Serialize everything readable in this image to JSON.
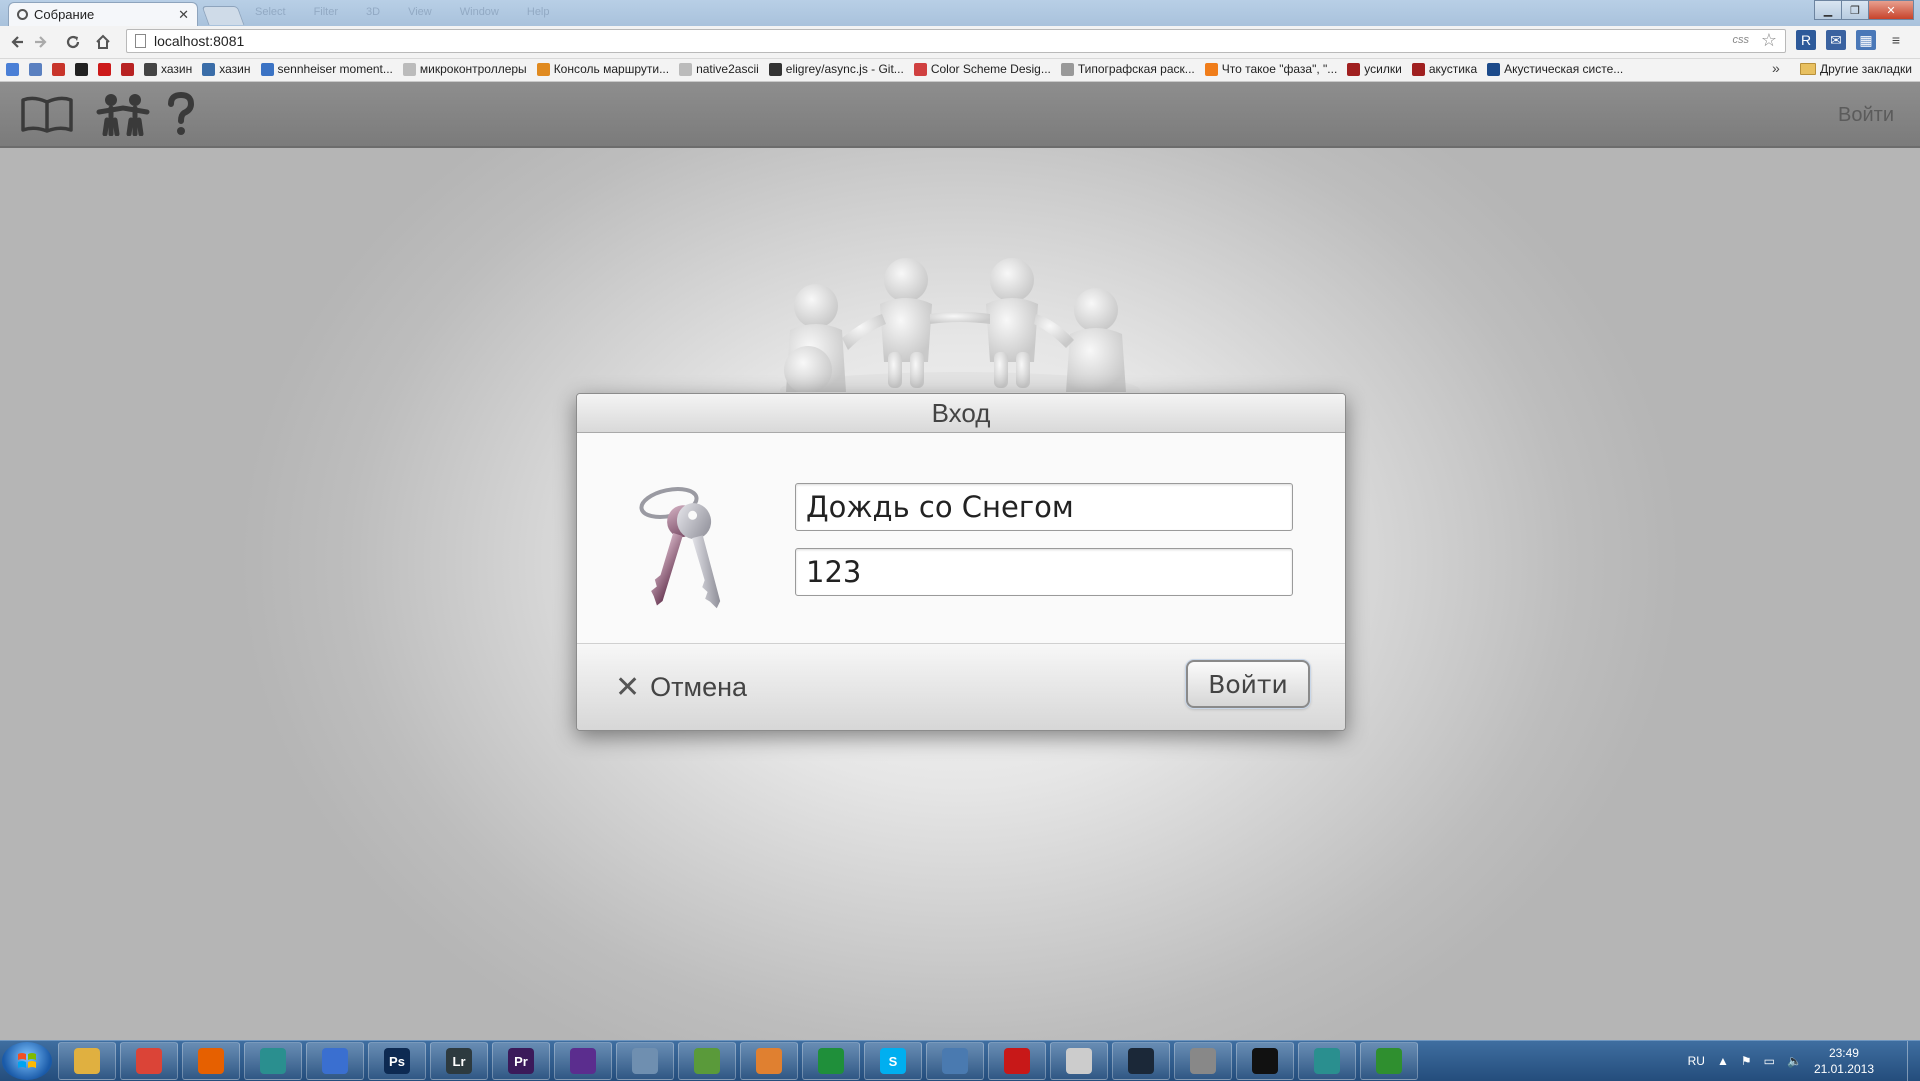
{
  "browser": {
    "tab_title": "Собрание",
    "address": "localhost:8081",
    "css_badge": "css",
    "ghost_menu": [
      "Select",
      "Filter",
      "3D",
      "View",
      "Window",
      "Help"
    ],
    "bookmarks": [
      {
        "label": "",
        "icon": "google-icon",
        "color": "#4a7fd6"
      },
      {
        "label": "",
        "icon": "h-icon",
        "color": "#5a80c0"
      },
      {
        "label": "",
        "icon": "pp-icon",
        "color": "#c8352b"
      },
      {
        "label": "",
        "icon": "infinity-icon",
        "color": "#222222"
      },
      {
        "label": "",
        "icon": "youtube-icon",
        "color": "#cc1a1a"
      },
      {
        "label": "",
        "icon": "bookmark-red-icon",
        "color": "#b82222"
      },
      {
        "label": "хазин",
        "icon": "link-icon",
        "color": "#444444"
      },
      {
        "label": "хазин",
        "icon": "chart-icon",
        "color": "#3a6da8"
      },
      {
        "label": "sennheiser moment...",
        "icon": "sennheiser-icon",
        "color": "#3b73c4"
      },
      {
        "label": "микроконтроллеры",
        "icon": "page-icon",
        "color": "#bbbbbb"
      },
      {
        "label": "Консоль маршрути...",
        "icon": "grid-icon",
        "color": "#e08a20"
      },
      {
        "label": "native2ascii",
        "icon": "page-icon",
        "color": "#bbbbbb"
      },
      {
        "label": "eligrey/async.js - Git...",
        "icon": "github-icon",
        "color": "#333333"
      },
      {
        "label": "Color Scheme Desig...",
        "icon": "color-wheel-icon",
        "color": "#d04040"
      },
      {
        "label": "Типографская раск...",
        "icon": "typography-icon",
        "color": "#999999"
      },
      {
        "label": "Что такое \"фаза\", \"...",
        "icon": "blogger-icon",
        "color": "#f07d1a"
      },
      {
        "label": "усилки",
        "icon": "f-icon",
        "color": "#a02020"
      },
      {
        "label": "акустика",
        "icon": "f-icon",
        "color": "#a02020"
      },
      {
        "label": "Акустическая систе...",
        "icon": "speaker-icon",
        "color": "#1c4a8a"
      }
    ],
    "other_bookmarks": "Другие закладки"
  },
  "app": {
    "login_link": "Войти",
    "header_icons": [
      "book-icon",
      "people-icon",
      "question-icon"
    ]
  },
  "dialog": {
    "title": "Вход",
    "username_value": "Дождь со Снегом",
    "password_value": "123",
    "cancel_label": "Отмена",
    "submit_label": "Войти"
  },
  "taskbar": {
    "apps": [
      {
        "icon": "explorer-icon",
        "label": "",
        "color": "#e0b040"
      },
      {
        "icon": "chrome-icon",
        "label": "",
        "color": "#db4437"
      },
      {
        "icon": "firefox-icon",
        "label": "",
        "color": "#e66000"
      },
      {
        "icon": "bird-icon",
        "label": "",
        "color": "#2a8f8f"
      },
      {
        "icon": "bolt-icon",
        "label": "",
        "color": "#3a6fd0"
      },
      {
        "icon": "photoshop-icon",
        "label": "Ps",
        "color": "#0d2a52"
      },
      {
        "icon": "lightroom-icon",
        "label": "Lr",
        "color": "#2d3a3f"
      },
      {
        "icon": "premiere-icon",
        "label": "Pr",
        "color": "#3b1a5a"
      },
      {
        "icon": "visual-studio-icon",
        "label": "",
        "color": "#5b2d8e"
      },
      {
        "icon": "disk-icon",
        "label": "",
        "color": "#6f8fb0"
      },
      {
        "icon": "notepad-icon",
        "label": "",
        "color": "#5a9a3a"
      },
      {
        "icon": "windows-live-icon",
        "label": "",
        "color": "#e08030"
      },
      {
        "icon": "utorrent-icon",
        "label": "",
        "color": "#1f8f3a"
      },
      {
        "icon": "skype-icon",
        "label": "S",
        "color": "#00aff0"
      },
      {
        "icon": "network-icon",
        "label": "",
        "color": "#4a7ab0"
      },
      {
        "icon": "acrobat-icon",
        "label": "",
        "color": "#c81818"
      },
      {
        "icon": "alien-icon",
        "label": "",
        "color": "#cccccc"
      },
      {
        "icon": "steam-icon",
        "label": "",
        "color": "#1b2838"
      },
      {
        "icon": "media-icon",
        "label": "",
        "color": "#888888"
      },
      {
        "icon": "console-icon",
        "label": "",
        "color": "#111111"
      },
      {
        "icon": "bird2-icon",
        "label": "",
        "color": "#2a8f8f"
      },
      {
        "icon": "leaf-icon",
        "label": "",
        "color": "#2f8f2f"
      }
    ],
    "language": "RU",
    "time": "23:49",
    "date": "21.01.2013"
  }
}
